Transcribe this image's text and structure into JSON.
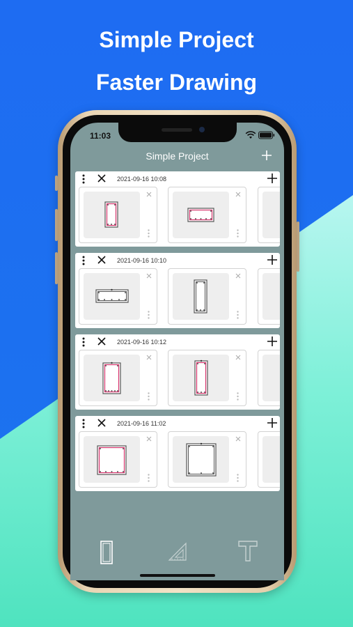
{
  "headlines": {
    "line1": "Simple Project",
    "line2": "Faster Drawing"
  },
  "status_bar": {
    "time": "11:03",
    "icons": [
      "wifi-icon",
      "battery-icon"
    ]
  },
  "nav": {
    "title": "Simple Project",
    "add_icon": "plus-icon"
  },
  "projects": [
    {
      "date": "2021-09-16 10:08"
    },
    {
      "date": "2021-09-16 10:10"
    },
    {
      "date": "2021-09-16 10:12"
    },
    {
      "date": "2021-09-16 11:02"
    }
  ],
  "tabbar": {
    "tabs": [
      "column-section-icon",
      "set-square-icon",
      "t-beam-icon"
    ]
  },
  "colors": {
    "blue": "#1f6ef0",
    "mint": "#63e6c5",
    "screen_bg": "#7f9a9b",
    "rebar_red": "#d6336c",
    "outline_gray": "#555555"
  }
}
